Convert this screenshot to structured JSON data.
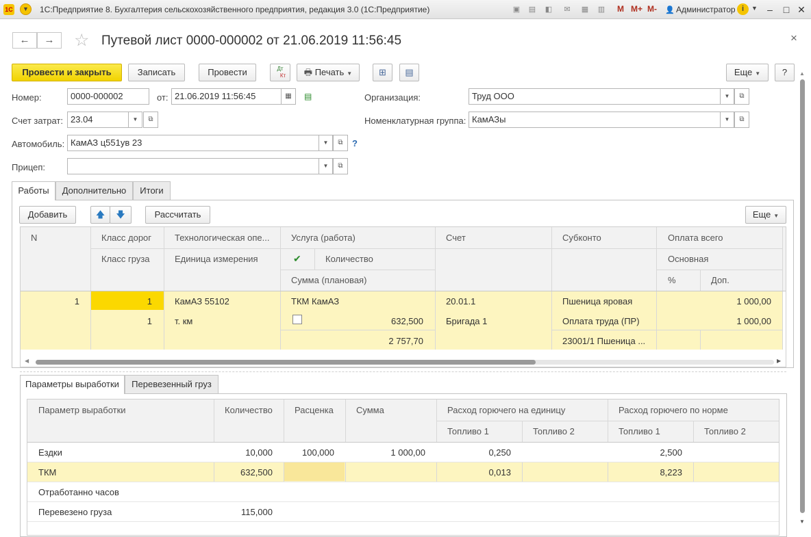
{
  "window": {
    "title": "1С:Предприятие 8. Бухгалтерия сельскохозяйственного предприятия, редакция 3.0  (1С:Предприятие)",
    "user": "Администратор"
  },
  "titlebar_letters": {
    "m": "M",
    "mplus": "M+",
    "mminus": "M-"
  },
  "form": {
    "title": "Путевой лист 0000-000002 от 21.06.2019 11:56:45",
    "close": "×"
  },
  "toolbar": {
    "post_close": "Провести и закрыть",
    "save": "Записать",
    "post": "Провести",
    "dt_top": "Дт",
    "dt_bottom": "Кт",
    "print": "Печать",
    "more": "Еще",
    "help": "?"
  },
  "fields": {
    "number_label": "Номер:",
    "number": "0000-000002",
    "from_label": "от:",
    "date": "21.06.2019 11:56:45",
    "org_label": "Организация:",
    "org": "Труд ООО",
    "account_label": "Счет затрат:",
    "account": "23.04",
    "nomgroup_label": "Номенклатурная группа:",
    "nomgroup": "КамАЗы",
    "car_label": "Автомобиль:",
    "car": "КамАЗ ц551ув 23",
    "car_help": "?",
    "trailer_label": "Прицеп:",
    "trailer": ""
  },
  "tabs": [
    "Работы",
    "Дополнительно",
    "Итоги"
  ],
  "works": {
    "add": "Добавить",
    "calc": "Рассчитать",
    "more": "Еще",
    "headers": {
      "n": "N",
      "road_class": "Класс дорог",
      "cargo_class": "Класс груза",
      "tech_op": "Технологическая опе...",
      "unit": "Единица измерения",
      "service": "Услуга (работа)",
      "qty": "Количество",
      "planned_sum": "Сумма (плановая)",
      "account": "Счет",
      "subconto": "Субконто",
      "pay_total": "Оплата всего",
      "main": "Основная",
      "pct": "%",
      "extra": "Доп."
    },
    "row": {
      "n": "1",
      "road_class": "1",
      "cargo_class": "1",
      "tech_op": "КамАЗ 55102",
      "unit": "т. км",
      "service": "ТКМ КамАЗ",
      "qty": "632,500",
      "planned_sum": "2 757,70",
      "account": "20.01.1",
      "brigade": "Бригада 1",
      "sub1": "Пшеница яровая",
      "sub2": "Оплата труда (ПР)",
      "sub3": "23001/1 Пшеница ...",
      "pay_total": "1 000,00",
      "main": "1 000,00"
    }
  },
  "bottom_tabs": [
    "Параметры выработки",
    "Перевезенный груз"
  ],
  "output": {
    "headers": {
      "param": "Параметр выработки",
      "qty": "Количество",
      "rate": "Расценка",
      "sum": "Сумма",
      "fuel_unit": "Расход горючего на единицу",
      "fuel_norm": "Расход горючего по норме",
      "f1": "Топливо 1",
      "f2": "Топливо 2"
    },
    "rows": [
      {
        "param": "Ездки",
        "qty": "10,000",
        "rate": "100,000",
        "sum": "1 000,00",
        "u1": "0,250",
        "u2": "",
        "n1": "2,500",
        "n2": ""
      },
      {
        "param": "ТКМ",
        "qty": "632,500",
        "rate": "",
        "sum": "",
        "u1": "0,013",
        "u2": "",
        "n1": "8,223",
        "n2": ""
      },
      {
        "param": "Отработанно часов",
        "qty": "",
        "rate": "",
        "sum": "",
        "u1": "",
        "u2": "",
        "n1": "",
        "n2": ""
      },
      {
        "param": "Перевезено груза",
        "qty": "115,000",
        "rate": "",
        "sum": "",
        "u1": "",
        "u2": "",
        "n1": "",
        "n2": ""
      }
    ]
  },
  "colors": {
    "primary": "#f1d300",
    "row_highlight": "#fdf5c0",
    "cell_active": "#fbd800"
  }
}
